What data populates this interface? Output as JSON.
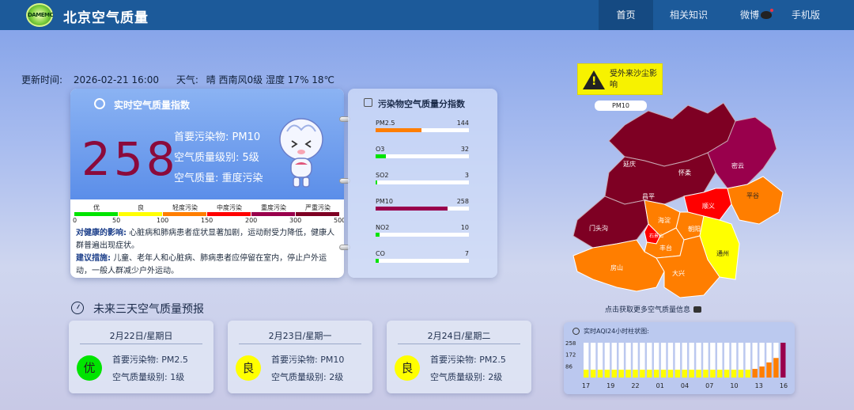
{
  "header": {
    "logo_text": "DAMEMC",
    "site_title": "北京空气质量",
    "nav": [
      "首页",
      "相关知识",
      "微博",
      "手机版"
    ]
  },
  "update": {
    "label": "更新时间:",
    "time": "2026-02-21 16:00",
    "weather_label": "天气:",
    "weather": "晴 西南风0级 湿度 17% 18℃"
  },
  "aqi": {
    "title": "实时空气质量指数",
    "value": "258",
    "primary_pollutant": "首要污染物: PM10",
    "level": "空气质量级别: 5级",
    "quality": "空气质量: 重度污染",
    "scale_labels": [
      "优",
      "良",
      "轻度污染",
      "中度污染",
      "重度污染",
      "严重污染"
    ],
    "scale_colors": [
      "#00e400",
      "#ffff00",
      "#ff7e00",
      "#ff0000",
      "#99004c",
      "#7e0023"
    ],
    "scale_ticks": [
      "0",
      "50",
      "100",
      "150",
      "200",
      "300",
      "500"
    ],
    "health_label": "对健康的影响:",
    "health_text": "心脏病和肺病患者症状显著加剧，运动耐受力降低，健康人群普遍出现症状。",
    "advice_label": "建议措施:",
    "advice_text": "儿童、老年人和心脏病、肺病患者应停留在室内，停止户外运动，一般人群减少户外运动。"
  },
  "pollutants": {
    "title": "污染物空气质量分指数",
    "items": [
      {
        "name": "PM2.5",
        "value": "144",
        "fill": 0.49,
        "color": "#ff7e00"
      },
      {
        "name": "O3",
        "value": "32",
        "fill": 0.11,
        "color": "#00e400"
      },
      {
        "name": "SO2",
        "value": "3",
        "fill": 0.02,
        "color": "#00e400"
      },
      {
        "name": "PM10",
        "value": "258",
        "fill": 0.77,
        "color": "#99004c"
      },
      {
        "name": "NO2",
        "value": "10",
        "fill": 0.04,
        "color": "#00e400"
      },
      {
        "name": "CO",
        "value": "7",
        "fill": 0.03,
        "color": "#00e400"
      }
    ]
  },
  "map": {
    "warning": "受外来沙尘影响",
    "tag": "PM10",
    "districts": [
      "延庆",
      "怀柔",
      "密云",
      "昌平",
      "顺义",
      "平谷",
      "门头沟",
      "海淀",
      "朝阳",
      "石景山",
      "丰台",
      "通州",
      "房山",
      "大兴"
    ],
    "hint": "点击获取更多空气质量信息"
  },
  "forecast": {
    "title": "未来三天空气质量预报",
    "days": [
      {
        "date": "2月22日/星期日",
        "badge": "优",
        "color": "#00e400",
        "pollutant": "首要污染物: PM2.5",
        "level": "空气质量级别: 1级"
      },
      {
        "date": "2月23日/星期一",
        "badge": "良",
        "color": "#ffff00",
        "pollutant": "首要污染物: PM10",
        "level": "空气质量级别: 2级"
      },
      {
        "date": "2月24日/星期二",
        "badge": "良",
        "color": "#ffff00",
        "pollutant": "首要污染物: PM2.5",
        "level": "空气质量级别: 2级"
      }
    ]
  },
  "chart_data": {
    "type": "bar",
    "title": "实时AQI24小时柱状图:",
    "y_ticks": [
      "258",
      "172",
      "86"
    ],
    "ylim": [
      0,
      258
    ],
    "x_ticks": [
      "17",
      "19",
      "22",
      "01",
      "04",
      "07",
      "10",
      "13",
      "16"
    ],
    "values": [
      58,
      58,
      58,
      58,
      58,
      58,
      58,
      58,
      58,
      58,
      58,
      58,
      58,
      58,
      58,
      58,
      58,
      58,
      58,
      58,
      58,
      58,
      58,
      58,
      64,
      82,
      112,
      145,
      258
    ],
    "colors": [
      "#ffff00",
      "#ffff00",
      "#ffff00",
      "#ffff00",
      "#ffff00",
      "#ffff00",
      "#ffff00",
      "#ffff00",
      "#ffff00",
      "#ffff00",
      "#ffff00",
      "#ffff00",
      "#ffff00",
      "#ffff00",
      "#ffff00",
      "#ffff00",
      "#ffff00",
      "#ffff00",
      "#ffff00",
      "#ffff00",
      "#ffff00",
      "#ffff00",
      "#ffff00",
      "#ffff00",
      "#ff7e00",
      "#ff7e00",
      "#ff7e00",
      "#ff7e00",
      "#99004c"
    ]
  }
}
